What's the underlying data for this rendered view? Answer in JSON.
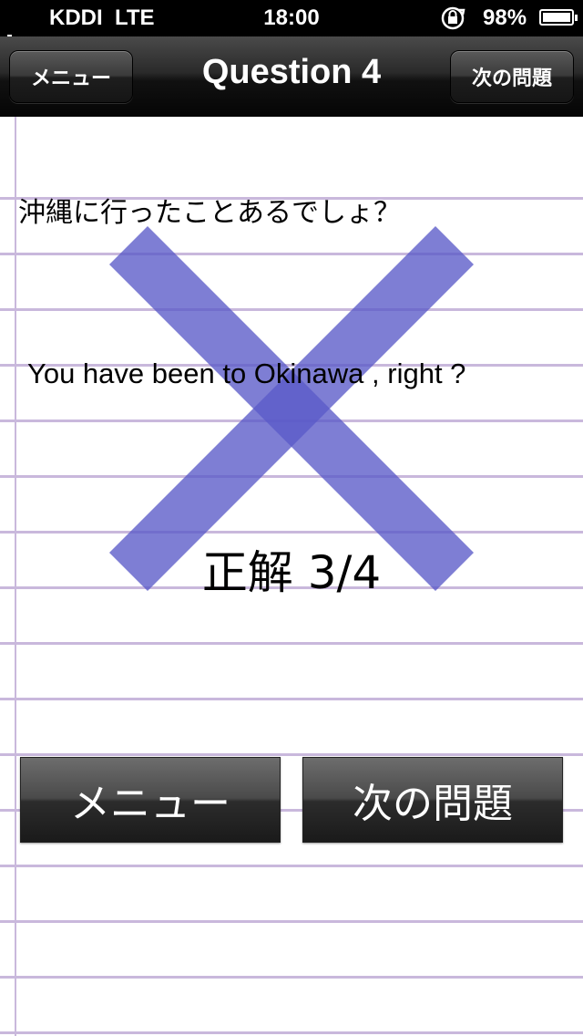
{
  "status_bar": {
    "carrier": "KDDI",
    "network": "LTE",
    "time": "18:00",
    "battery_percent": "98%",
    "icons": [
      "signal-icon",
      "rotation-lock-icon",
      "battery-icon"
    ]
  },
  "nav": {
    "menu_label": "メニュー",
    "title": "Question 4",
    "next_label": "次の問題"
  },
  "content": {
    "japanese_question": "沖縄に行ったことあるでしょ？",
    "english_answer": "You have been to Okinawa , right ?",
    "score": "正解 3/4",
    "result_icon": "cross-mark-icon",
    "result_color": "#5a5ac8"
  },
  "buttons": {
    "menu_label": "メニュー",
    "next_label": "次の問題"
  }
}
